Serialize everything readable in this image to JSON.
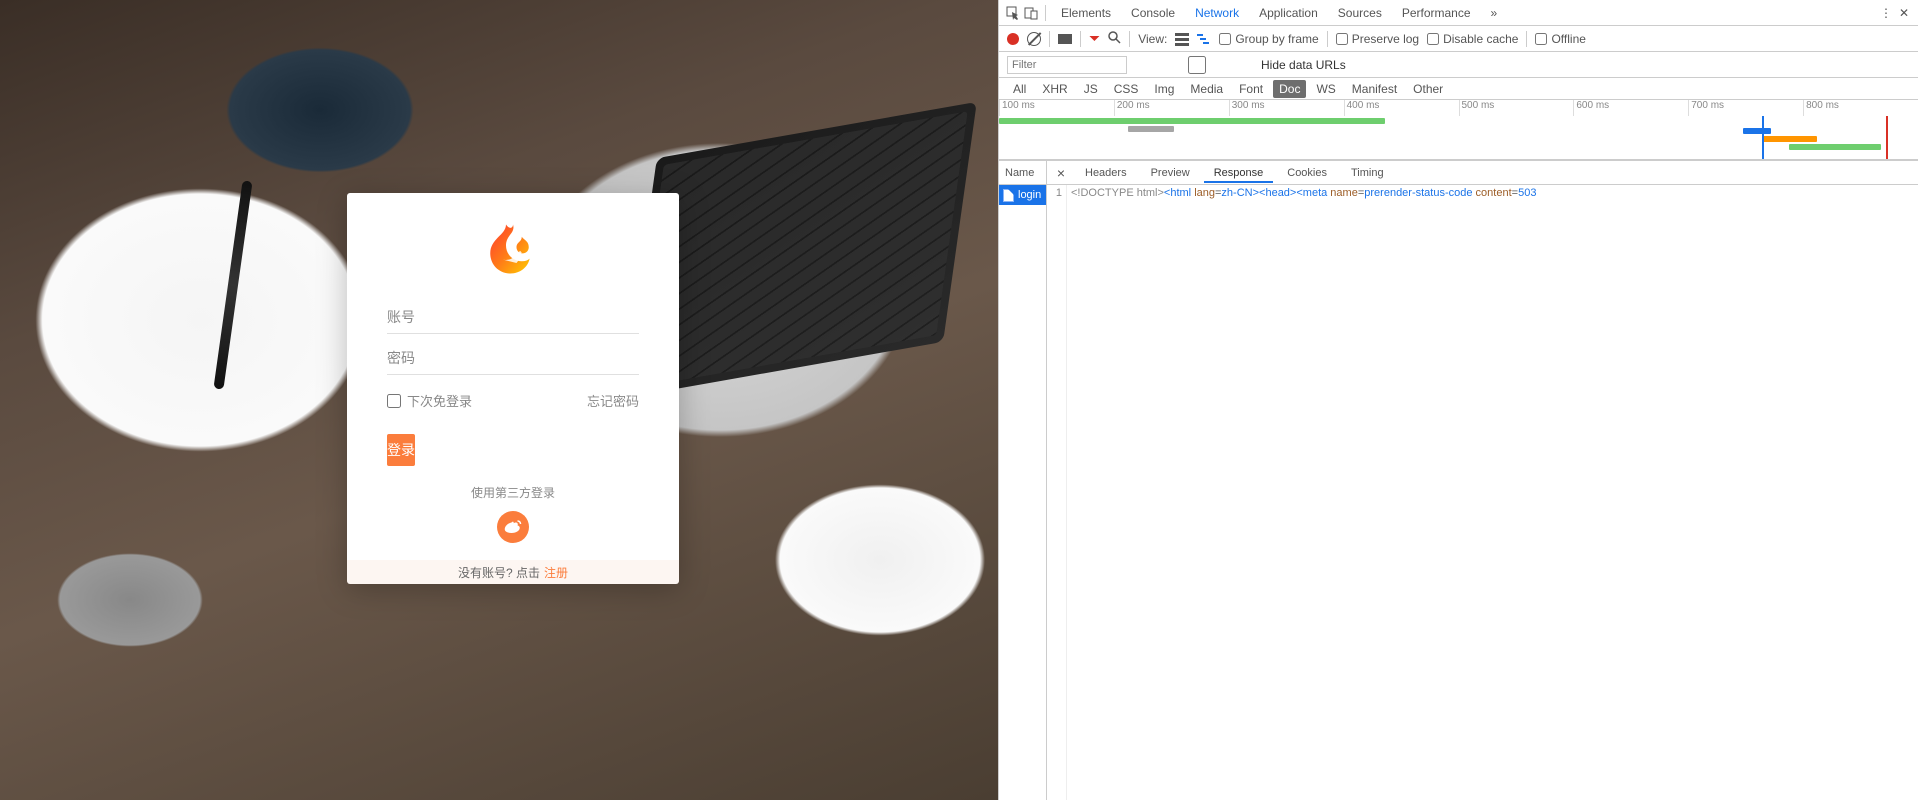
{
  "login": {
    "username_placeholder": "账号",
    "password_placeholder": "密码",
    "remember_label": "下次免登录",
    "forgot_label": "忘记密码",
    "submit_label": "登录",
    "third_party_label": "使用第三方登录",
    "no_account_prefix": "没有账号? 点击",
    "register_link": "注册"
  },
  "devtools": {
    "panels": [
      "Elements",
      "Console",
      "Network",
      "Application",
      "Sources",
      "Performance"
    ],
    "active_panel": "Network",
    "toolbar": {
      "view_label": "View:",
      "group_by_frame": "Group by frame",
      "preserve_log": "Preserve log",
      "disable_cache": "Disable cache",
      "offline": "Offline"
    },
    "filter": {
      "placeholder": "Filter",
      "hide_data_urls": "Hide data URLs"
    },
    "filter_types": [
      "All",
      "XHR",
      "JS",
      "CSS",
      "Img",
      "Media",
      "Font",
      "Doc",
      "WS",
      "Manifest",
      "Other"
    ],
    "active_filter_type": "Doc",
    "timeline_ticks": [
      "100 ms",
      "200 ms",
      "300 ms",
      "400 ms",
      "500 ms",
      "600 ms",
      "700 ms",
      "800 ms"
    ],
    "request_list_header": "Name",
    "requests": [
      {
        "name": "login"
      }
    ],
    "detail_tabs": [
      "Headers",
      "Preview",
      "Response",
      "Cookies",
      "Timing"
    ],
    "active_detail_tab": "Response",
    "response": {
      "line_no": "1",
      "doctype": "<!DOCTYPE html>",
      "html_open": "<html ",
      "lang_attr": "lang",
      "lang_eq": "=",
      "lang_val": "zh-CN",
      "html_close": ">",
      "head": "<head>",
      "meta_open": "<meta ",
      "name_attr": "name",
      "name_eq": "=",
      "name_val": "prerender-status-code",
      "content_attr": " content",
      "content_eq": "=",
      "content_val": "503"
    }
  }
}
